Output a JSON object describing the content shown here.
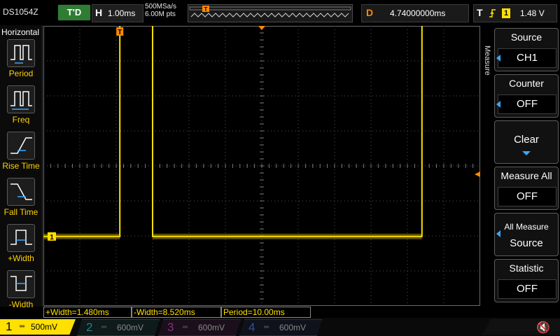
{
  "top": {
    "model": "DS1054Z",
    "trigger_status": "T'D",
    "timebase_label": "H",
    "timebase": "1.00ms",
    "sample_rate": "500MSa/s",
    "mem_depth": "6.00M pts",
    "delay_label": "D",
    "delay": "4.74000000ms",
    "trigger_label": "T",
    "trigger_source": "1",
    "trigger_level": "1.48 V"
  },
  "left_panel": {
    "title": "Horizontal",
    "items": [
      {
        "label": "Period",
        "icon": "period-icon"
      },
      {
        "label": "Freq",
        "icon": "frequency-icon"
      },
      {
        "label": "Rise Time",
        "icon": "rise-time-icon"
      },
      {
        "label": "Fall Time",
        "icon": "fall-time-icon"
      },
      {
        "label": "+Width",
        "icon": "positive-width-icon"
      },
      {
        "label": "-Width",
        "icon": "negative-width-icon"
      }
    ]
  },
  "right_menu": {
    "tab": "Measure",
    "buttons": [
      {
        "title": "Source",
        "value": "CH1"
      },
      {
        "title": "Counter",
        "value": "OFF"
      },
      {
        "title": "Clear",
        "value": ""
      },
      {
        "title": "Measure All",
        "value": "OFF"
      },
      {
        "title": "All Measure",
        "value": "Source"
      },
      {
        "title": "Statistic",
        "value": "OFF"
      }
    ]
  },
  "measurements": [
    "+Width=1.480ms",
    "-Width=8.520ms",
    "Period=10.00ms"
  ],
  "channels": [
    {
      "num": "1",
      "scale": "500mV",
      "color": "#ffe000",
      "active": true
    },
    {
      "num": "2",
      "scale": "600mV",
      "color": "#00c8c8",
      "active": false
    },
    {
      "num": "3",
      "scale": "600mV",
      "color": "#e040e0",
      "active": false
    },
    {
      "num": "4",
      "scale": "600mV",
      "color": "#3d7cff",
      "active": false
    }
  ],
  "markers": {
    "trigger_position": "T",
    "channel_marker": "1"
  },
  "colors": {
    "ch1": "#ffe000",
    "trigger": "#ff8a00",
    "accent": "#39a8ff",
    "grid": "#555555"
  },
  "waveform": {
    "type": "square",
    "high_level_div": 4.6,
    "low_level_div": -2.1,
    "edges_div": [
      -3.9,
      -3.0,
      4.4
    ],
    "positive_width_div": 0.9
  }
}
